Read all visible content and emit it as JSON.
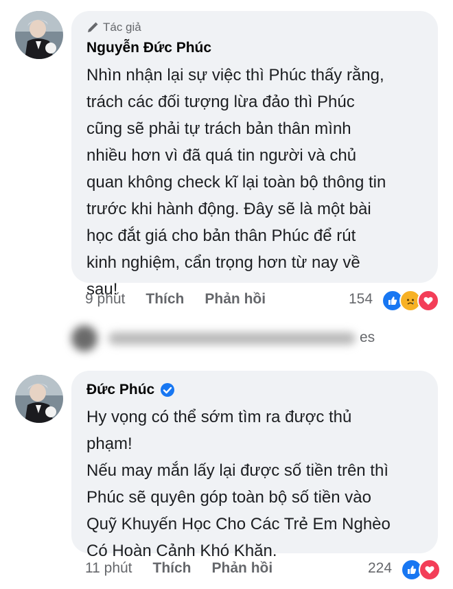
{
  "comments": [
    {
      "badge": "Tác giả",
      "author": "Nguyễn Đức Phúc",
      "text": "Nhìn nhận lại sự việc thì Phúc thấy rằng,\ntrách các đối tượng lừa đảo thì Phúc\ncũng sẽ phải tự trách bản thân mình\nnhiều hơn vì đã quá tin người và chủ\nquan không check kĩ lại toàn bộ thông tin\ntrước khi hành động. Đây sẽ là một bài\nhọc đắt giá cho bản thân Phúc để rút\nkinh nghiệm, cẩn trọng hơn từ nay về\nsau!",
      "time": "9 phút",
      "like_label": "Thích",
      "reply_label": "Phản hồi",
      "reaction_count": "154",
      "reactions": [
        "like-icon",
        "sad-icon",
        "love-icon"
      ]
    },
    {
      "author": "Đức Phúc",
      "text": "Hy vọng có thể sớm tìm ra được thủ\nphạm!\nNếu may mắn lấy lại được số tiền trên thì\nPhúc sẽ quyên góp toàn bộ số tiền vào\nQuỹ Khuyến Học Cho Các Trẻ Em Nghèo\nCó Hoàn Cảnh Khó Khăn.",
      "time": "11 phút",
      "like_label": "Thích",
      "reply_label": "Phản hồi",
      "reaction_count": "224",
      "reactions": [
        "like-icon",
        "love-icon"
      ]
    }
  ],
  "replies_link": "es",
  "colors": {
    "like": "#1877f2",
    "love": "#f33e58",
    "sad": "#f7b125",
    "verified": "#1877f2"
  }
}
